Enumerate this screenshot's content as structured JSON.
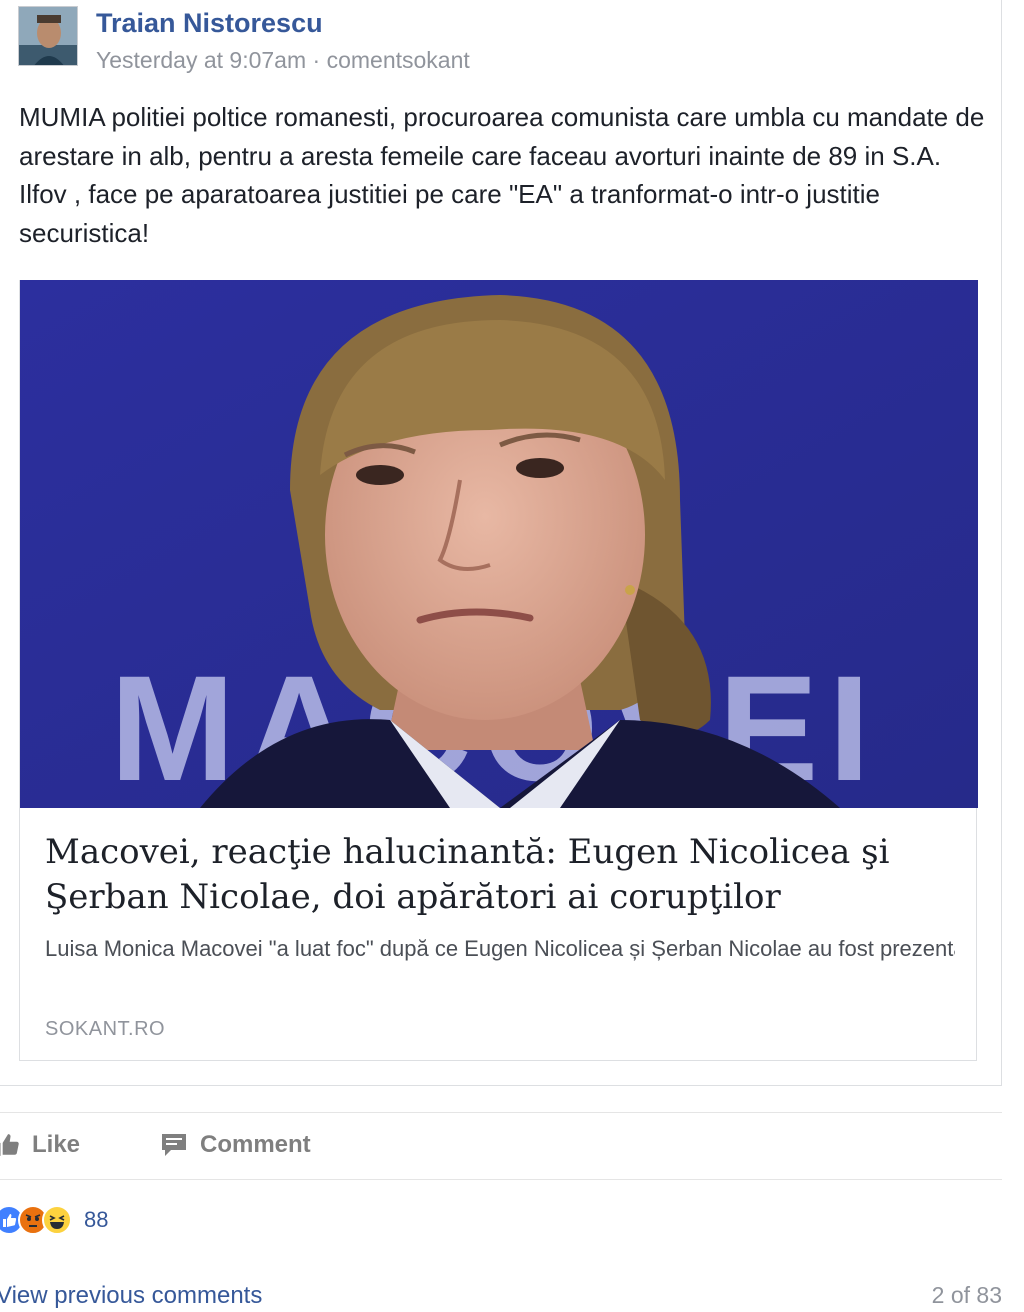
{
  "post": {
    "author": "Traian Nistorescu",
    "timestamp": "Yesterday at 9:07am",
    "separator": " · ",
    "via": "comentsokant",
    "text": "MUMIA politiei poltice romanesti, procuroarea comunista care umbla cu mandate de arestare in alb, pentru a aresta femeile care faceau avorturi inainte de 89 in S.A. Ilfov , face pe aparatoarea justitiei pe care \"EA\" a tranformat-o intr-o justitie securistica!"
  },
  "link": {
    "photo_backdrop_text": "MACOVEI",
    "title": "Macovei, reacţie halucinantă: Eugen Nicolicea şi Şerban Nicolae, doi apărători ai corupţilor",
    "description": "Luisa Monica Macovei \"a luat foc\" după ce Eugen Nicolicea și Șerban Nicolae au fost prezentați ca alegerile lui Dragnea pentru a fi lideri ai deputaților și...",
    "domain": "SOKANT.RO"
  },
  "actions": {
    "like_label": "Like",
    "comment_label": "Comment"
  },
  "reactions": {
    "types": [
      "like",
      "angry",
      "haha"
    ],
    "count": "88",
    "colors": {
      "like": "#4080ff",
      "angry": "#e9710f",
      "haha": "#fcd23f"
    }
  },
  "comments": {
    "view_previous": "View previous comments",
    "page_indicator": "2 of 83"
  },
  "colors": {
    "link_blue": "#365899",
    "meta_gray": "#90949c",
    "photo_backdrop": "#2b2f9b"
  }
}
